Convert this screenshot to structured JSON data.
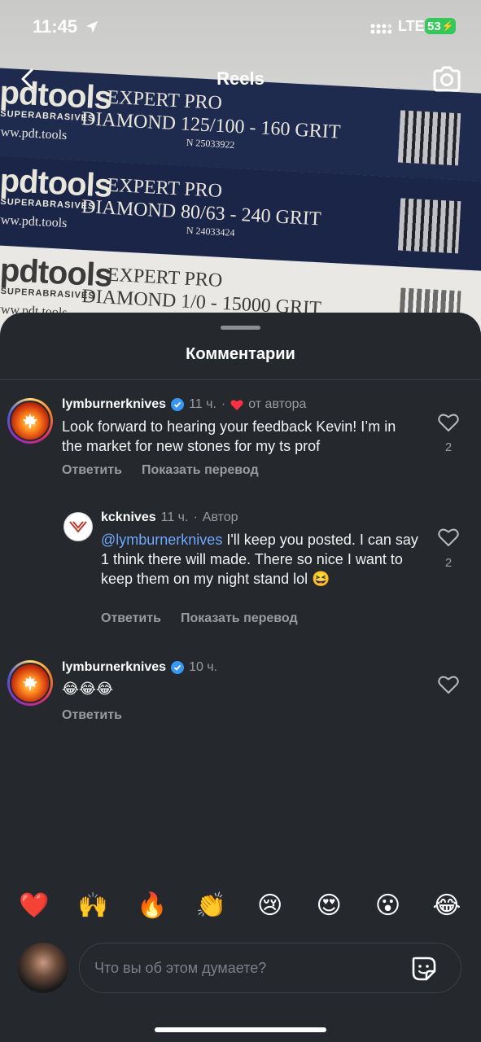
{
  "status_bar": {
    "time": "11:45",
    "network": "LTE",
    "battery": "53"
  },
  "nav": {
    "title": "Reels"
  },
  "video_frame": {
    "boxes": [
      {
        "brand": "pdtools",
        "sub": "SUPERABRASIVES",
        "url": "www.pdt.tools",
        "line1": "EXPERT PRO",
        "line2": "DIAMOND 125/100 - 160 GRIT",
        "serial": "N 25033922"
      },
      {
        "brand": "pdtools",
        "sub": "SUPERABRASIVES",
        "url": "www.pdt.tools",
        "line1": "EXPERT PRO",
        "line2": "DIAMOND 80/63 - 240 GRIT",
        "serial": "N 24033424"
      },
      {
        "brand": "pdtools",
        "sub": "SUPERABRASIVES",
        "url": "www.pdt.tools",
        "line1": "EXPERT PRO",
        "line2": "DIAMOND 1/0 - 15000 GRIT",
        "serial": ""
      }
    ]
  },
  "sheet": {
    "title": "Комментарии"
  },
  "comments": [
    {
      "username": "lymburnerknives",
      "time": "11 ч.",
      "dot": "·",
      "author_like": "от автора",
      "text": "Look forward to hearing your feedback Kevin! I’m in the market for new stones for my ts prof",
      "likes": "2",
      "reply_label": "Ответить",
      "translate_label": "Показать перевод"
    },
    {
      "username": "kcknives",
      "time": "11 ч.",
      "dot": "·",
      "author_badge": "Автор",
      "mention": "@lymburnerknives",
      "text": " I'll keep you posted. I can say 1 think there will made. There so nice I want to keep them on my night stand lol 😆",
      "likes": "2",
      "reply_label": "Ответить",
      "translate_label": "Показать перевод"
    },
    {
      "username": "lymburnerknives",
      "time": "10 ч.",
      "text": "😂😂😂",
      "reply_label": "Ответить"
    }
  ],
  "reactions": [
    "❤️",
    "🙌",
    "🔥",
    "👏",
    "😢",
    "😍",
    "😮",
    "😂"
  ],
  "composer": {
    "placeholder": "Что вы об этом думаете?"
  },
  "colors": {
    "sheet_bg": "#25282d",
    "heart_red": "#ff3040",
    "verified_blue": "#3897f0",
    "battery_green": "#34c759"
  }
}
